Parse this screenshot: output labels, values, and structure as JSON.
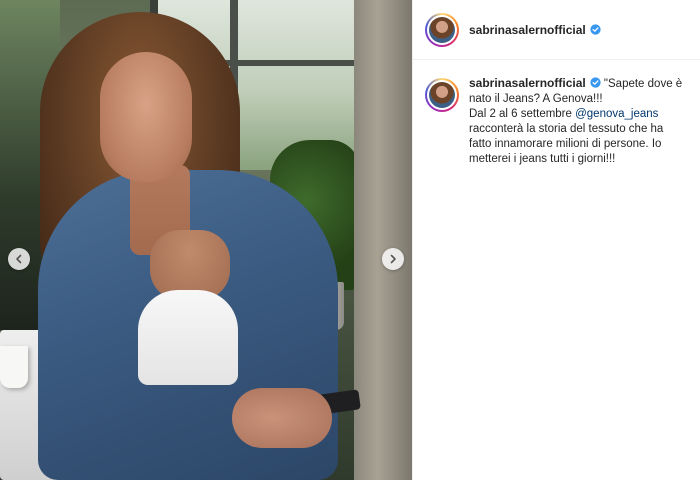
{
  "post": {
    "username": "sabrinasalernofficial",
    "verified": true,
    "caption": {
      "line1": "\"Sapete dove è nato il Jeans? A Genova!!!",
      "line2_prefix": "Dal 2 al 6 settembre ",
      "mention": "@genova_jeans",
      "line2_suffix": " racconterà la storia del tessuto che ha fatto innamorare milioni di persone. Io metterei i jeans tutti i giorni!!!"
    }
  },
  "media": {
    "prev_icon": "chevron-left-icon",
    "next_icon": "chevron-right-icon"
  },
  "colors": {
    "accent_verified": "#3897f0",
    "link": "#00376b",
    "text": "#262626"
  }
}
